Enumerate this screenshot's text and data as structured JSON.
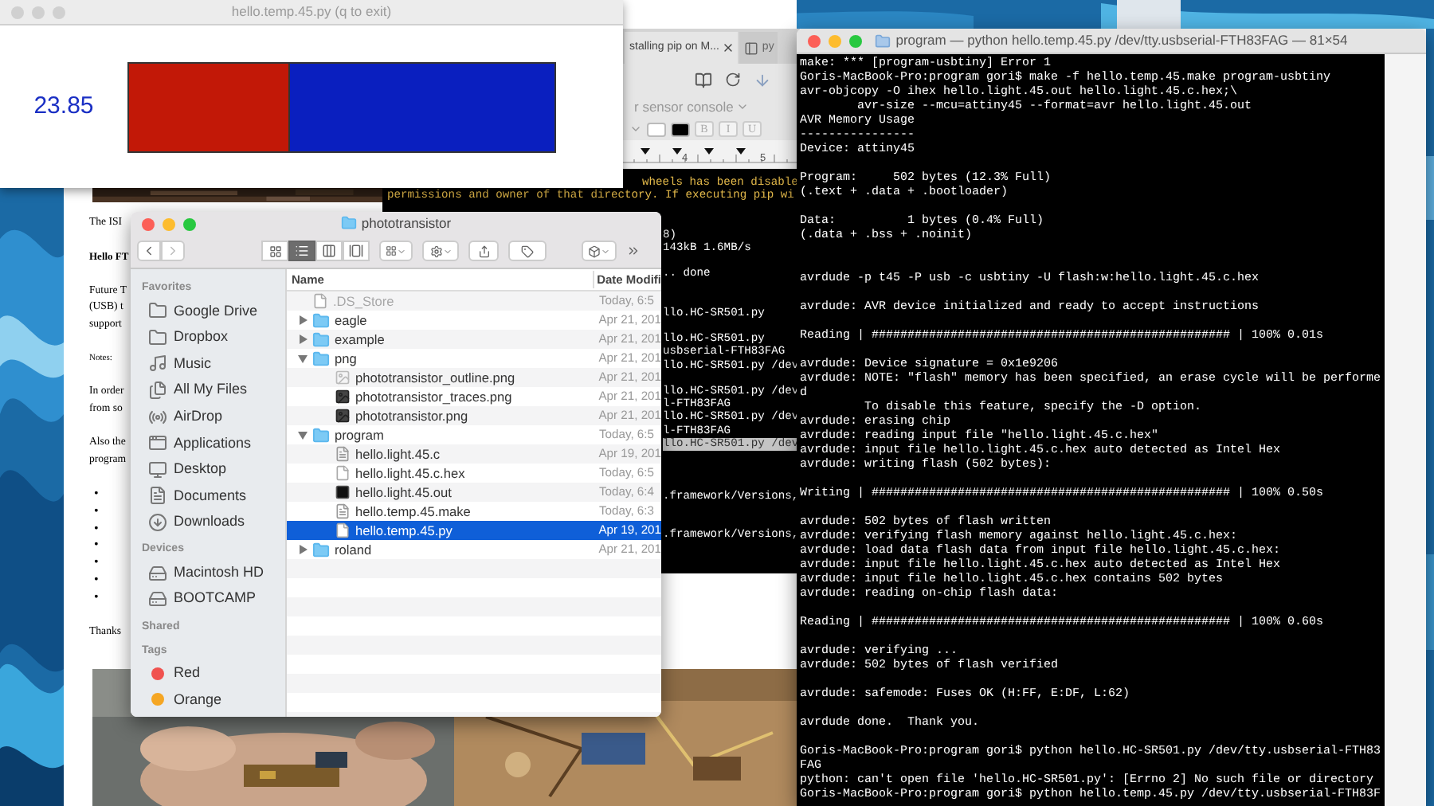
{
  "temperature_window": {
    "title": "hello.temp.45.py (q to exit)",
    "reading": "23.85",
    "level": 0.38
  },
  "document_window": {
    "paragraphs": [
      {
        "kind": "body",
        "lines": [
          "The ISI"
        ]
      },
      {
        "kind": "heading",
        "lines": [
          "Hello FT"
        ]
      },
      {
        "kind": "body",
        "lines": [
          "Future T",
          "(USB) t",
          "support"
        ]
      },
      {
        "kind": "note",
        "lines": [
          "Notes:"
        ]
      },
      {
        "kind": "body",
        "lines": [
          "In order",
          "from so"
        ]
      },
      {
        "kind": "body",
        "lines": [
          "Also the",
          "program"
        ]
      },
      {
        "kind": "bullets",
        "lines": [
          "•",
          "•",
          "•",
          "•",
          "•",
          "•",
          "•"
        ]
      },
      {
        "kind": "body",
        "lines": [
          "Thanks"
        ]
      }
    ]
  },
  "browser_window": {
    "tabs": [
      {
        "label": "stalling pip on M...",
        "selected": true
      },
      {
        "label": "py",
        "selected": false
      }
    ],
    "document_title": "r sensor console",
    "format_buttons": [
      "B",
      "I",
      "U"
    ],
    "ruler_labels": [
      "4",
      "5"
    ],
    "console_partial_line": "wheels has been disable",
    "console_line": "permissions and owner of that directory. If executing pip wi",
    "console_fragments": [
      {
        "kind": "text",
        "text": "8)",
        "highlighted": false
      },
      {
        "kind": "text",
        "text": "143kB 1.6MB/s",
        "highlighted": false
      },
      {
        "kind": "blank"
      },
      {
        "kind": "text",
        "text": ".. done",
        "highlighted": false
      },
      {
        "kind": "blank"
      },
      {
        "kind": "blank"
      },
      {
        "kind": "text",
        "text": "llo.HC-SR501.py",
        "highlighted": false
      },
      {
        "kind": "blank"
      },
      {
        "kind": "text",
        "text": "llo.HC-SR501.py",
        "highlighted": false
      },
      {
        "kind": "text",
        "text": "usbserial-FTH83FAG",
        "highlighted": false
      },
      {
        "kind": "text",
        "text": "llo.HC-SR501.py /dev",
        "highlighted": false
      },
      {
        "kind": "blank"
      },
      {
        "kind": "text",
        "text": "llo.HC-SR501.py /dev",
        "highlighted": false
      },
      {
        "kind": "text",
        "text": "l-FTH83FAG",
        "highlighted": false
      },
      {
        "kind": "text",
        "text": "llo.HC-SR501.py /dev",
        "highlighted": false
      },
      {
        "kind": "text",
        "text": "l-FTH83FAG",
        "highlighted": false
      },
      {
        "kind": "text",
        "text": "llo.HC-SR501.py /dev",
        "highlighted": true
      },
      {
        "kind": "blank"
      },
      {
        "kind": "blank"
      },
      {
        "kind": "blank"
      },
      {
        "kind": "text",
        "text": ".framework/Versions,",
        "highlighted": false
      },
      {
        "kind": "blank"
      },
      {
        "kind": "blank"
      },
      {
        "kind": "text",
        "text": ".framework/Versions,",
        "highlighted": false
      }
    ]
  },
  "finder": {
    "title": "phototransistor",
    "sidebar": [
      {
        "title": "Favorites",
        "items": [
          {
            "label": "Google Drive",
            "kind": "folder"
          },
          {
            "label": "Dropbox",
            "kind": "folder"
          },
          {
            "label": "Music",
            "kind": "music"
          },
          {
            "label": "All My Files",
            "kind": "files"
          },
          {
            "label": "AirDrop",
            "kind": "airdrop"
          },
          {
            "label": "Applications",
            "kind": "applications"
          },
          {
            "label": "Desktop",
            "kind": "desktop"
          },
          {
            "label": "Documents",
            "kind": "documents"
          },
          {
            "label": "Downloads",
            "kind": "downloads"
          }
        ]
      },
      {
        "title": "Devices",
        "items": [
          {
            "label": "Macintosh HD",
            "kind": "disk"
          },
          {
            "label": "BOOTCAMP",
            "kind": "disk"
          }
        ]
      },
      {
        "title": "Shared"
      },
      {
        "title": "Tags",
        "items": [
          {
            "label": "Red",
            "kind": "tag",
            "color": "#f0524f"
          },
          {
            "label": "Orange",
            "kind": "tag",
            "color": "#f5a623"
          }
        ]
      }
    ],
    "columns": [
      "Name",
      "Date Modifi"
    ],
    "rows": [
      {
        "name": ".DS_Store",
        "date": "Today, 6:5",
        "kind": "blank_file",
        "dimmed": true,
        "selected": false
      },
      {
        "name": "eagle",
        "date": "Apr 21, 201",
        "kind": "folder",
        "expanded": false,
        "dimmed": false,
        "selected": false
      },
      {
        "name": "example",
        "date": "Apr 21, 201",
        "kind": "folder",
        "expanded": false,
        "dimmed": false,
        "selected": false
      },
      {
        "name": "png",
        "date": "Apr 21, 201",
        "kind": "folder",
        "expanded": true,
        "dimmed": false,
        "selected": false,
        "children": [
          {
            "name": "phototransistor_outline.png",
            "date": "Apr 21, 201",
            "kind": "image_light",
            "dimmed": false,
            "selected": false
          },
          {
            "name": "phototransistor_traces.png",
            "date": "Apr 21, 201",
            "kind": "image_dark",
            "dimmed": false,
            "selected": false
          },
          {
            "name": "phototransistor.png",
            "date": "Apr 21, 201",
            "kind": "image_dark",
            "dimmed": false,
            "selected": false
          }
        ]
      },
      {
        "name": "program",
        "date": "Today, 6:5",
        "kind": "folder",
        "expanded": true,
        "dimmed": false,
        "selected": false,
        "children": [
          {
            "name": "hello.light.45.c",
            "date": "Apr 19, 201",
            "kind": "text_file",
            "dimmed": false,
            "selected": false
          },
          {
            "name": "hello.light.45.c.hex",
            "date": "Today, 6:5",
            "kind": "blank_file",
            "dimmed": false,
            "selected": false
          },
          {
            "name": "hello.light.45.out",
            "date": "Today, 6:4",
            "kind": "executable",
            "dimmed": false,
            "selected": false
          },
          {
            "name": "hello.temp.45.make",
            "date": "Today, 6:3",
            "kind": "text_file",
            "dimmed": false,
            "selected": false
          },
          {
            "name": "hello.temp.45.py",
            "date": "Apr 19, 201",
            "kind": "blank_file",
            "dimmed": false,
            "selected": true
          }
        ]
      },
      {
        "name": "roland",
        "date": "Apr 21, 201",
        "kind": "folder",
        "expanded": false,
        "dimmed": false,
        "selected": false
      }
    ]
  },
  "terminal": {
    "title": "program — python hello.temp.45.py /dev/tty.usbserial-FTH83FAG — 81×54",
    "lines": [
      {
        "kind": "text",
        "text": "make: *** [program-usbtiny] Error 1"
      },
      {
        "kind": "text",
        "text": "Goris-MacBook-Pro:program gori$ make -f hello.temp.45.make program-usbtiny"
      },
      {
        "kind": "text",
        "text": "avr-objcopy -O ihex hello.light.45.out hello.light.45.c.hex;\\"
      },
      {
        "kind": "text",
        "text": "        avr-size --mcu=attiny45 --format=avr hello.light.45.out"
      },
      {
        "kind": "text",
        "text": "AVR Memory Usage"
      },
      {
        "kind": "text",
        "text": "----------------"
      },
      {
        "kind": "text",
        "text": "Device: attiny45"
      },
      {
        "kind": "blank"
      },
      {
        "kind": "text",
        "text": "Program:     502 bytes (12.3% Full)"
      },
      {
        "kind": "text",
        "text": "(.text + .data + .bootloader)"
      },
      {
        "kind": "blank"
      },
      {
        "kind": "text",
        "text": "Data:          1 bytes (0.4% Full)"
      },
      {
        "kind": "text",
        "text": "(.data + .bss + .noinit)"
      },
      {
        "kind": "blank"
      },
      {
        "kind": "blank"
      },
      {
        "kind": "text",
        "text": "avrdude -p t45 -P usb -c usbtiny -U flash:w:hello.light.45.c.hex"
      },
      {
        "kind": "blank"
      },
      {
        "kind": "text",
        "text": "avrdude: AVR device initialized and ready to accept instructions"
      },
      {
        "kind": "blank"
      },
      {
        "kind": "text",
        "text": "Reading | ################################################## | 100% 0.01s"
      },
      {
        "kind": "blank"
      },
      {
        "kind": "text",
        "text": "avrdude: Device signature = 0x1e9206"
      },
      {
        "kind": "text",
        "text": "avrdude: NOTE: \"flash\" memory has been specified, an erase cycle will be performe"
      },
      {
        "kind": "text",
        "text": "d"
      },
      {
        "kind": "text",
        "text": "         To disable this feature, specify the -D option."
      },
      {
        "kind": "text",
        "text": "avrdude: erasing chip"
      },
      {
        "kind": "text",
        "text": "avrdude: reading input file \"hello.light.45.c.hex\""
      },
      {
        "kind": "text",
        "text": "avrdude: input file hello.light.45.c.hex auto detected as Intel Hex"
      },
      {
        "kind": "text",
        "text": "avrdude: writing flash (502 bytes):"
      },
      {
        "kind": "blank"
      },
      {
        "kind": "text",
        "text": "Writing | ################################################## | 100% 0.50s"
      },
      {
        "kind": "blank"
      },
      {
        "kind": "text",
        "text": "avrdude: 502 bytes of flash written"
      },
      {
        "kind": "text",
        "text": "avrdude: verifying flash memory against hello.light.45.c.hex:"
      },
      {
        "kind": "text",
        "text": "avrdude: load data flash data from input file hello.light.45.c.hex:"
      },
      {
        "kind": "text",
        "text": "avrdude: input file hello.light.45.c.hex auto detected as Intel Hex"
      },
      {
        "kind": "text",
        "text": "avrdude: input file hello.light.45.c.hex contains 502 bytes"
      },
      {
        "kind": "text",
        "text": "avrdude: reading on-chip flash data:"
      },
      {
        "kind": "blank"
      },
      {
        "kind": "text",
        "text": "Reading | ################################################## | 100% 0.60s"
      },
      {
        "kind": "blank"
      },
      {
        "kind": "text",
        "text": "avrdude: verifying ..."
      },
      {
        "kind": "text",
        "text": "avrdude: 502 bytes of flash verified"
      },
      {
        "kind": "blank"
      },
      {
        "kind": "text",
        "text": "avrdude: safemode: Fuses OK (H:FF, E:DF, L:62)"
      },
      {
        "kind": "blank"
      },
      {
        "kind": "text",
        "text": "avrdude done.  Thank you."
      },
      {
        "kind": "blank"
      },
      {
        "kind": "text",
        "text": "Goris-MacBook-Pro:program gori$ python hello.HC-SR501.py /dev/tty.usbserial-FTH83"
      },
      {
        "kind": "text",
        "text": "FAG"
      },
      {
        "kind": "text",
        "text": "python: can't open file 'hello.HC-SR501.py': [Errno 2] No such file or directory"
      },
      {
        "kind": "text",
        "text": "Goris-MacBook-Pro:program gori$ python hello.temp.45.py /dev/tty.usbserial-FTH83F"
      }
    ]
  }
}
